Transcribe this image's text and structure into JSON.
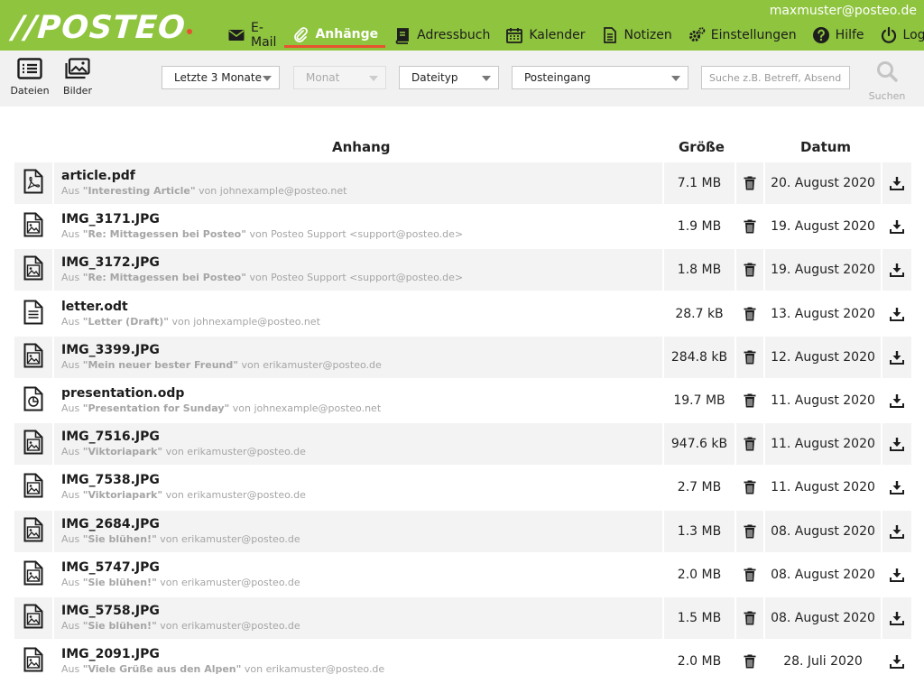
{
  "header": {
    "logo_text": "//POSTEO",
    "user_email": "maxmuster@posteo.de",
    "nav": [
      {
        "label": "E-Mail",
        "icon": "envelope-icon"
      },
      {
        "label": "Anhänge",
        "icon": "paperclip-icon",
        "active": true
      },
      {
        "label": "Adressbuch",
        "icon": "address-book-icon"
      },
      {
        "label": "Kalender",
        "icon": "calendar-icon"
      },
      {
        "label": "Notizen",
        "icon": "notes-icon"
      },
      {
        "label": "Einstellungen",
        "icon": "gear-icon"
      },
      {
        "label": "Hilfe",
        "icon": "help-icon"
      },
      {
        "label": "Logout",
        "icon": "power-icon"
      }
    ]
  },
  "toolbar": {
    "files_label": "Dateien",
    "images_label": "Bilder",
    "period_select": "Letzte 3 Monate",
    "month_select": "Monat",
    "filetype_select": "Dateityp",
    "folder_select": "Posteingang",
    "search_placeholder": "Suche z.B. Betreff, Absender",
    "search_label": "Suchen"
  },
  "table": {
    "headers": {
      "attachment": "Anhang",
      "size": "Größe",
      "date": "Datum"
    },
    "from_prefix": "Aus",
    "by_word": "von",
    "rows": [
      {
        "file": "article.pdf",
        "type": "pdf",
        "subject": "\"Interesting Article\"",
        "sender": "johnexample@posteo.net",
        "size": "7.1 MB",
        "date": "20. August 2020"
      },
      {
        "file": "IMG_3171.JPG",
        "type": "image",
        "subject": "\"Re: Mittagessen bei Posteo\"",
        "sender": "Posteo Support <support@posteo.de>",
        "size": "1.9 MB",
        "date": "19. August 2020"
      },
      {
        "file": "IMG_3172.JPG",
        "type": "image",
        "subject": "\"Re: Mittagessen bei Posteo\"",
        "sender": "Posteo Support <support@posteo.de>",
        "size": "1.8 MB",
        "date": "19. August 2020"
      },
      {
        "file": "letter.odt",
        "type": "text",
        "subject": "\"Letter (Draft)\"",
        "sender": "johnexample@posteo.net",
        "size": "28.7 kB",
        "date": "13. August 2020"
      },
      {
        "file": "IMG_3399.JPG",
        "type": "image",
        "subject": "\"Mein neuer bester Freund\"",
        "sender": "erikamuster@posteo.de",
        "size": "284.8 kB",
        "date": "12. August 2020"
      },
      {
        "file": "presentation.odp",
        "type": "presentation",
        "subject": "\"Presentation for Sunday\"",
        "sender": "johnexample@posteo.net",
        "size": "19.7 MB",
        "date": "11. August 2020"
      },
      {
        "file": "IMG_7516.JPG",
        "type": "image",
        "subject": "\"Viktoriapark\"",
        "sender": "erikamuster@posteo.de",
        "size": "947.6 kB",
        "date": "11. August 2020"
      },
      {
        "file": "IMG_7538.JPG",
        "type": "image",
        "subject": "\"Viktoriapark\"",
        "sender": "erikamuster@posteo.de",
        "size": "2.7 MB",
        "date": "11. August 2020"
      },
      {
        "file": "IMG_2684.JPG",
        "type": "image",
        "subject": "\"Sie blühen!\"",
        "sender": "erikamuster@posteo.de",
        "size": "1.3 MB",
        "date": "08. August 2020"
      },
      {
        "file": "IMG_5747.JPG",
        "type": "image",
        "subject": "\"Sie blühen!\"",
        "sender": "erikamuster@posteo.de",
        "size": "2.0 MB",
        "date": "08. August 2020"
      },
      {
        "file": "IMG_5758.JPG",
        "type": "image",
        "subject": "\"Sie blühen!\"",
        "sender": "erikamuster@posteo.de",
        "size": "1.5 MB",
        "date": "08. August 2020"
      },
      {
        "file": "IMG_2091.JPG",
        "type": "image",
        "subject": "\"Viele Grüße aus den Alpen\"",
        "sender": "erikamuster@posteo.de",
        "size": "2.0 MB",
        "date": "28. Juli 2020"
      }
    ]
  },
  "colors": {
    "brand_green": "#8fc43f",
    "accent_orange": "#e8532f",
    "row_alt": "#f3f3f3"
  }
}
